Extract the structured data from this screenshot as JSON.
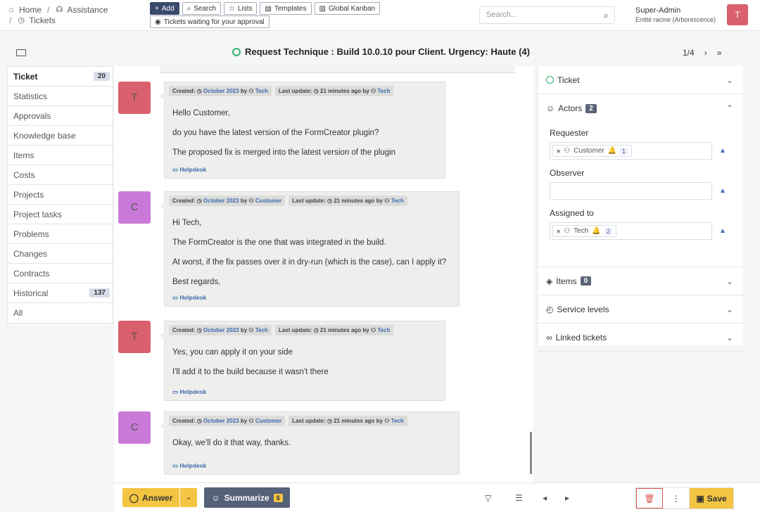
{
  "breadcrumb": {
    "home": "Home",
    "assistance": "Assistance",
    "tickets": "Tickets",
    "sep1": "/",
    "sep2": "/"
  },
  "toolbar": {
    "add": "Add",
    "search": "Search",
    "lists": "Lists",
    "templates": "Templates",
    "kanban": "Global Kanban",
    "waiting": "Tickets waiting for your approval"
  },
  "search": {
    "placeholder": "Search..."
  },
  "user": {
    "name": "Super-Admin",
    "entity": "Entité racine (Arborescence)",
    "initial": "T"
  },
  "ticket": {
    "title": "Request Technique : Build 10.0.10 pour Client. Urgency: Haute (4)",
    "pager": "1/4"
  },
  "nav": [
    {
      "label": "Ticket",
      "count": "20"
    },
    {
      "label": "Statistics"
    },
    {
      "label": "Approvals"
    },
    {
      "label": "Knowledge base"
    },
    {
      "label": "Items"
    },
    {
      "label": "Costs"
    },
    {
      "label": "Projects"
    },
    {
      "label": "Project tasks"
    },
    {
      "label": "Problems"
    },
    {
      "label": "Changes"
    },
    {
      "label": "Contracts"
    },
    {
      "label": "Historical",
      "count": "137"
    },
    {
      "label": "All"
    }
  ],
  "meta_labels": {
    "created": "Created:",
    "by": "by",
    "last_update": "Last update:",
    "ago": "21 minutes ago",
    "date": "October 2023"
  },
  "followups": [
    {
      "initial": "T",
      "author": "Tech",
      "updater": "Tech",
      "lines": [
        "Hello Customer,",
        "do you have the latest version of the FormCreator plugin?",
        "The proposed fix is merged into the latest version of the plugin"
      ],
      "source": "Helpdesk"
    },
    {
      "initial": "C",
      "author": "Customer",
      "updater": "Tech",
      "lines": [
        "Hi Tech,",
        "The FormCreator is the one that was integrated in the build.",
        "At worst, if the fix passes over it in dry-run (which is the case), can I apply it?",
        "Best regards,"
      ],
      "source": "Helpdesk"
    },
    {
      "initial": "T",
      "author": "Tech",
      "updater": "Tech",
      "lines": [
        "Yes, you can apply it on your side",
        "I'll add it to the build because it wasn't there"
      ],
      "source": "Helpdesk"
    },
    {
      "initial": "C",
      "author": "Customer",
      "updater": "Tech",
      "lines": [
        "Okay, we'll do it that way, thanks."
      ],
      "source": "Helpdesk"
    }
  ],
  "panel": {
    "ticket": "Ticket",
    "actors": "Actors",
    "actors_count": "2",
    "requester": "Requester",
    "requester_name": "Customer",
    "requester_count": "1",
    "observer": "Observer",
    "assigned": "Assigned to",
    "assigned_name": "Tech",
    "assigned_count": "2",
    "items": "Items",
    "items_count": "0",
    "service_levels": "Service levels",
    "linked": "Linked tickets"
  },
  "bottom": {
    "answer": "Answer",
    "summarize": "Summarize",
    "dollar": "$",
    "save": "Save"
  },
  "colors": {
    "tech_avatar": "#d9606c",
    "customer_avatar": "#c97ad8",
    "accent": "#f4c542",
    "primary": "#3a4a6b"
  }
}
